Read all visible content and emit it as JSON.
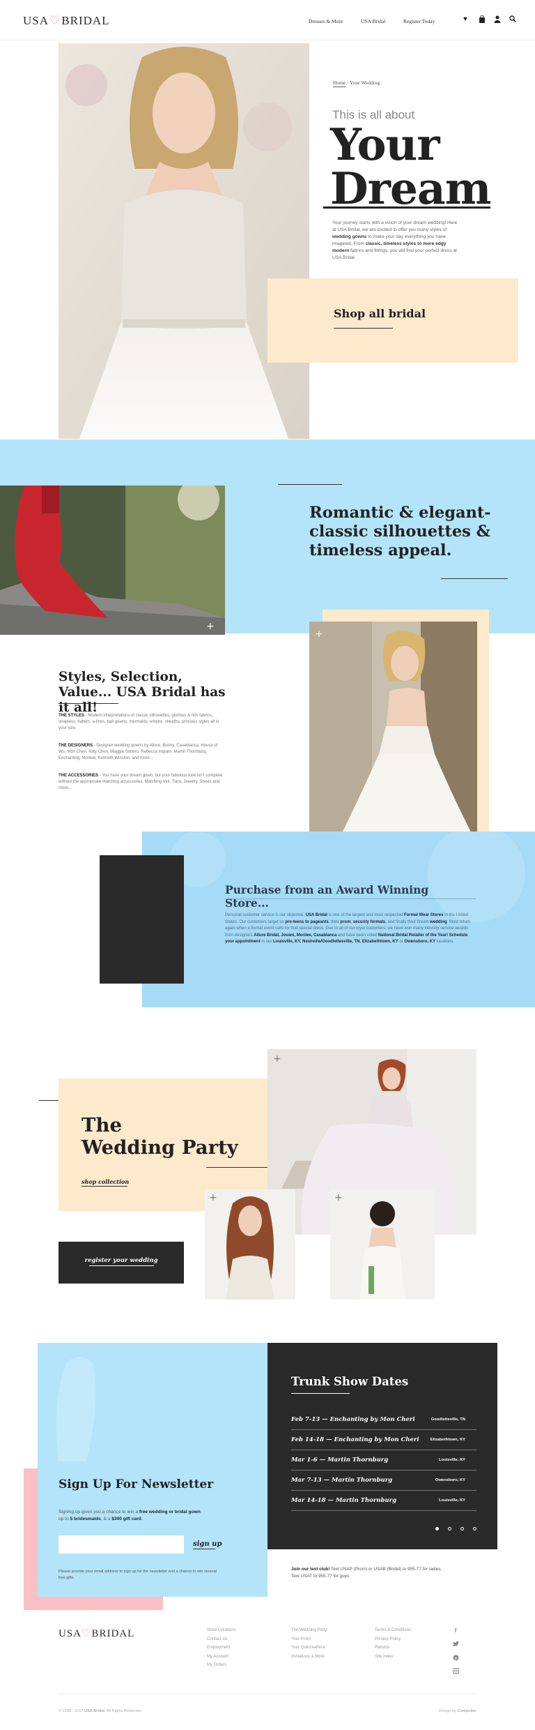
{
  "header": {
    "logo_left": "USA",
    "logo_right": "BRIDAL",
    "nav": [
      "Dresses & More",
      "USA Bridal",
      "Register Today"
    ],
    "icons": [
      "heart-icon",
      "bag-icon",
      "user-icon",
      "search-icon"
    ]
  },
  "hero": {
    "breadcrumb_home": "Home",
    "breadcrumb_sep": "/",
    "breadcrumb_current": "Your Wedding",
    "pre": "This is all about",
    "title_1": "Your",
    "title_2": "Dream",
    "body_1": "Your journey starts with a vision of your dream wedding! Here at USA Bridal, we are excited to offer you many styles of ",
    "body_b1": "wedding gowns",
    "body_2": " to make your day everything you have imagined. From ",
    "body_b2": "classic, timeless styles to more edgy modern",
    "body_3": " fabrics and fittings, you will find your perfect dress at USA Bridal.",
    "shop_button": "Shop all bridal"
  },
  "romantic": {
    "title": "Romantic & elegant-classic silhouettes & timeless appeal."
  },
  "styles": {
    "title": "Styles, Selection, Value... USA Bridal has it all!",
    "p1_label": "THE STYLES",
    "p1": " - Modern interpretations of classic silhouettes, glorious & rich fabrics, strapless, halters, a-lines, ball gowns, mermaids, empire, sheaths, princess styles all in your size.",
    "p2_label": "THE DESIGNERS",
    "p2": " - Designer wedding gowns by Allure, Bonny, Casablanca, House of Wu, Mon Cheri, Kitty Chen, Maggie Sottero, Rebecca Ingram, Martin Thornburg, Enchanting, Morilee, Kenneth Winston, and more...",
    "p3_label": "THE ACCESSORIES",
    "p3": " - You have your dream gown, but your fabulous look isn't complete without the appropriate matching accessories. Matching Veil, Tiara, Jewelry, Shoes and more..."
  },
  "award": {
    "title": "Purchase from an Award Winning Store...",
    "body_1": "Personal customer service is our objective. ",
    "body_b1": "USA Bridal",
    "body_2": " is one of the largest and most respected ",
    "body_b2": "Formal Wear Stores",
    "body_3": " in the United States. Our customers target us ",
    "body_b3": "pre-teens to pageants",
    "body_4": ", their ",
    "body_b4": "prom",
    "body_5": ", ",
    "body_b5": "security formals",
    "body_6": ", and finally their dream ",
    "body_b6": "wedding",
    "body_7": ". Most return again when a formal event calls for that special dress. Due to all of our loyal customers, we have won many industry service awards from designers ",
    "body_b7": "Allure Bridal, Jovani, Morilee, Casablanca",
    "body_8": " and have been voted ",
    "body_b8": "National Bridal Retailer of the Year! Schedule your appointment",
    "body_9": " in our ",
    "body_b9": "Louisville, KY, Nashville/Goodlettesville, TN, Elizabethtown, KY",
    "body_10": " or ",
    "body_b10": "Owensboro, KY",
    "body_11": " locations."
  },
  "party": {
    "title_1": "The",
    "title_2": "Wedding Party",
    "shop": "shop collection",
    "register": "register your wedding"
  },
  "newsletter": {
    "title": "Sign Up For Newsletter",
    "body_1": "Signing up gives you a chance to win a ",
    "body_b1": "free wedding or bridal gown",
    "body_2": ", up to ",
    "body_b2": "5 bridesmaids",
    "body_3": ", & a ",
    "body_b3": "$300 gift card",
    "body_4": ".",
    "input_placeholder": "",
    "button": "sign up",
    "note": "Please provide your email address to sign up for the newsletter and a chance to win several free gifts."
  },
  "trunk": {
    "title": "Trunk Show Dates",
    "rows": [
      {
        "date": "Feb 7-13",
        "name": "Enchanting by Mon Cheri",
        "loc": "Goodlettsville, TN"
      },
      {
        "date": "Feb 14-18",
        "name": "Enchanting by Mon Cheri",
        "loc": "Elizabethtown, KY"
      },
      {
        "date": "Mar 1-6",
        "name": "Martin Thornburg",
        "loc": "Louisville, KY"
      },
      {
        "date": "Mar 7-13",
        "name": "Martin Thornburg",
        "loc": "Owensboro, KY"
      },
      {
        "date": "Mar 14-18",
        "name": "Martin Thornburg",
        "loc": "Louisville, KY"
      }
    ],
    "sep": " — "
  },
  "text_club": {
    "bold": "Join our text club!",
    "body": " Text USAP (Prom) or USAB (Bridal) to 955-77 for ladies. Text USAT to 955-77 for guys"
  },
  "footer": {
    "logo_left": "USA",
    "logo_right": "BRIDAL",
    "col1": [
      "Store Locations",
      "Contact Us",
      "Employment",
      "My Account",
      "My Orders"
    ],
    "col2": [
      "The Wedding Party",
      "Your Prom",
      "Your Quinceañera",
      "Invitations & More"
    ],
    "col3": [
      "Terms & Conditions",
      "Privacy Policy",
      "Returns",
      "Site Index"
    ],
    "social": [
      "facebook-icon",
      "twitter-icon",
      "pinterest-icon",
      "instagram-icon"
    ],
    "copyright_1": "© 1998 - 2017 ",
    "copyright_b": "USA Bridal",
    "copyright_2": ". All Rights Reserved.",
    "design_1": "Design by ",
    "design_b": "Compulse"
  },
  "colors": {
    "peach": "#fde9cc",
    "sky": "#b3e4fa",
    "dark": "#2a2a2a",
    "pink": "#fbc0c4"
  }
}
